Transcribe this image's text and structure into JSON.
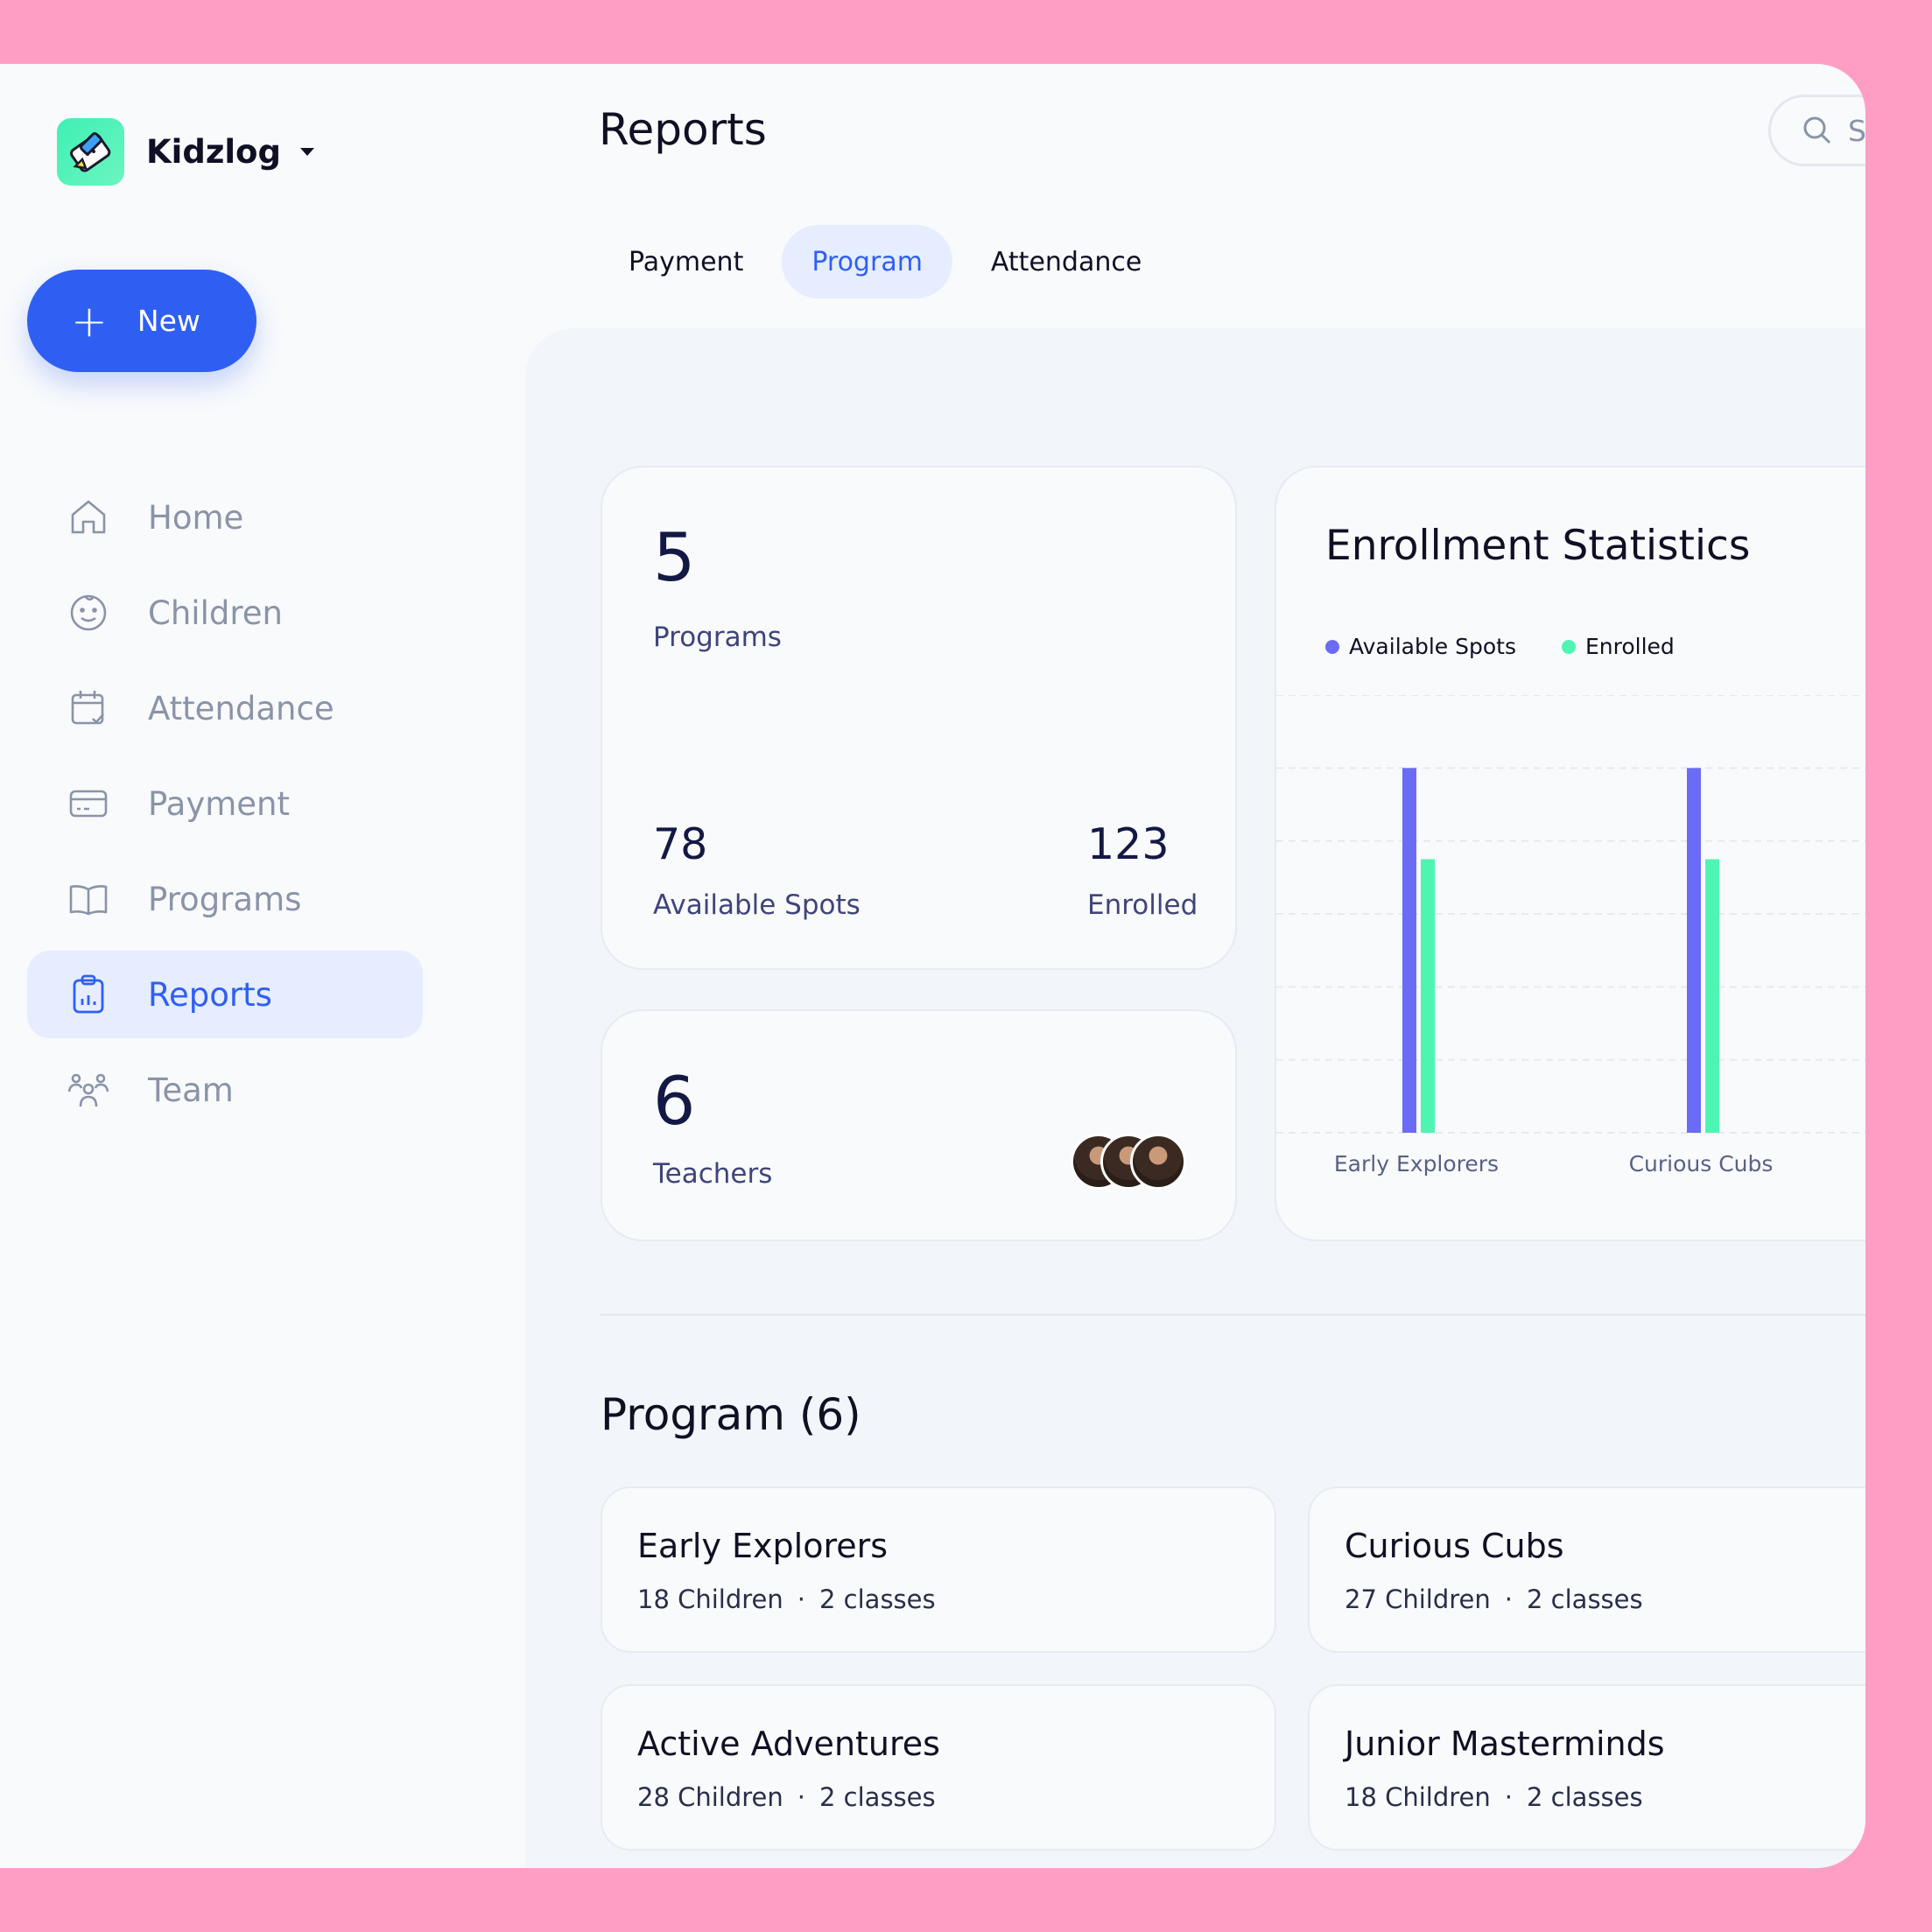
{
  "brand": {
    "name": "Kidzlog"
  },
  "new_button": {
    "label": "New"
  },
  "nav": [
    {
      "label": "Home",
      "icon": "home-icon"
    },
    {
      "label": "Children",
      "icon": "smiley-icon"
    },
    {
      "label": "Attendance",
      "icon": "calendar-check-icon"
    },
    {
      "label": "Payment",
      "icon": "card-icon"
    },
    {
      "label": "Programs",
      "icon": "book-icon"
    },
    {
      "label": "Reports",
      "icon": "clipboard-chart-icon",
      "active": true
    },
    {
      "label": "Team",
      "icon": "team-icon"
    }
  ],
  "header": {
    "title": "Reports",
    "search_placeholder": "S"
  },
  "tabs": [
    {
      "label": "Payment"
    },
    {
      "label": "Program",
      "active": true
    },
    {
      "label": "Attendance"
    }
  ],
  "stats": {
    "programs_count": "5",
    "programs_label": "Programs",
    "available_count": "78",
    "available_label": "Available Spots",
    "enrolled_count": "123",
    "enrolled_label": "Enrolled",
    "teachers_count": "6",
    "teachers_label": "Teachers"
  },
  "chart_data": {
    "type": "bar",
    "title": "Enrollment Statistics",
    "categories": [
      "Early Explorers",
      "Curious Cubs"
    ],
    "series": [
      {
        "name": "Available Spots",
        "color": "#6a6cf6",
        "values": [
          100,
          100
        ]
      },
      {
        "name": "Enrolled",
        "color": "#4ef5b2",
        "values": [
          75,
          75
        ]
      }
    ],
    "ylim": [
      0,
      120
    ],
    "grid": true,
    "legend": "top-left"
  },
  "section": {
    "title": "Program (6)"
  },
  "programs": [
    {
      "name": "Early Explorers",
      "children": "18 Children",
      "classes": "2 classes"
    },
    {
      "name": "Curious Cubs",
      "children": "27 Children",
      "classes": "2 classes"
    },
    {
      "name": "Active Adventures",
      "children": "28 Children",
      "classes": "2 classes"
    },
    {
      "name": "Junior Masterminds",
      "children": "18 Children",
      "classes": "2 classes"
    }
  ],
  "colors": {
    "accent": "#2f5ff2",
    "background_frame": "#ff9ec4"
  }
}
